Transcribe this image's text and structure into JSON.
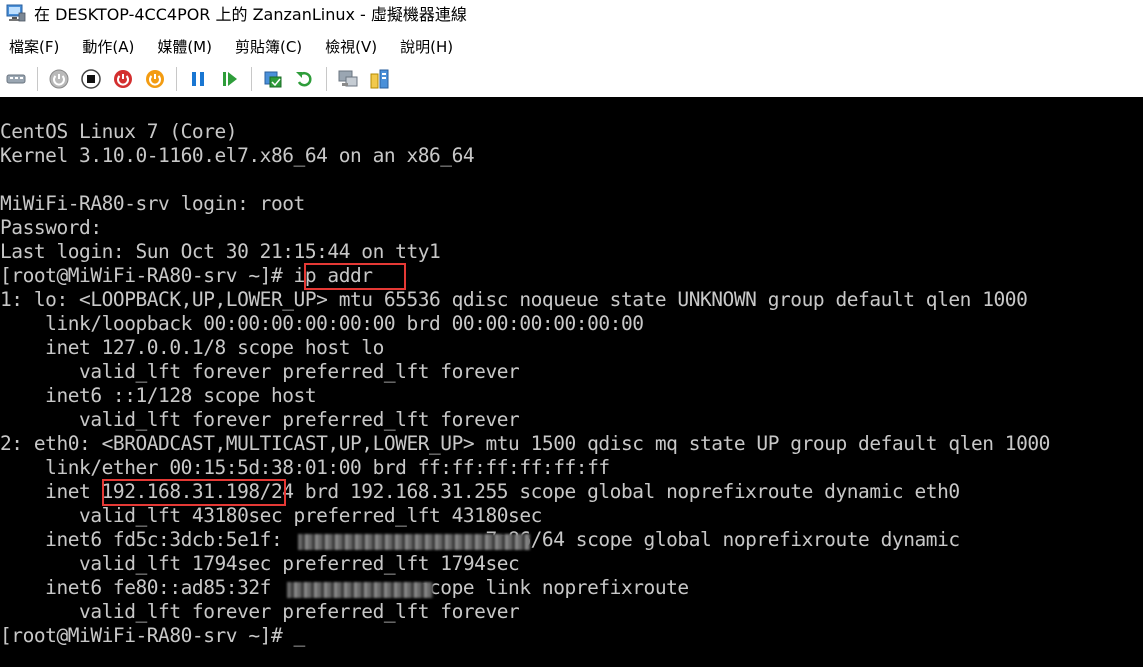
{
  "window": {
    "title": "在 DESKTOP-4CC4POR 上的 ZanzanLinux - 虛擬機器連線"
  },
  "menu": {
    "items": [
      {
        "id": "file",
        "label": "檔案(F)"
      },
      {
        "id": "action",
        "label": "動作(A)"
      },
      {
        "id": "media",
        "label": "媒體(M)"
      },
      {
        "id": "clipboard",
        "label": "剪貼簿(C)"
      },
      {
        "id": "view",
        "label": "檢視(V)"
      },
      {
        "id": "help",
        "label": "說明(H)"
      }
    ]
  },
  "toolbar": {
    "icons": [
      "ctrl-alt-del-icon",
      "start-icon",
      "turn-off-icon",
      "shutdown-icon",
      "save-icon",
      "pause-icon",
      "resume-icon",
      "checkpoint-icon",
      "revert-icon",
      "enhanced-session-icon",
      "share-icon"
    ],
    "colors": {
      "red": "#d32f2f",
      "orange": "#f39c12",
      "blue": "#1976d2",
      "green": "#2e9d3a",
      "gray": "#8a8a8a"
    }
  },
  "console": {
    "lines": [
      "CentOS Linux 7 (Core)",
      "Kernel 3.10.0-1160.el7.x86_64 on an x86_64",
      "",
      "MiWiFi-RA80-srv login: root",
      "Password:",
      "Last login: Sun Oct 30 21:15:44 on tty1",
      "[root@MiWiFi-RA80-srv ~]# ip addr",
      "1: lo: <LOOPBACK,UP,LOWER_UP> mtu 65536 qdisc noqueue state UNKNOWN group default qlen 1000",
      "    link/loopback 00:00:00:00:00:00 brd 00:00:00:00:00:00",
      "    inet 127.0.0.1/8 scope host lo",
      "       valid_lft forever preferred_lft forever",
      "    inet6 ::1/128 scope host",
      "       valid_lft forever preferred_lft forever",
      "2: eth0: <BROADCAST,MULTICAST,UP,LOWER_UP> mtu 1500 qdisc mq state UP group default qlen 1000",
      "    link/ether 00:15:5d:38:01:00 brd ff:ff:ff:ff:ff:ff",
      "    inet 192.168.31.198/24 brd 192.168.31.255 scope global noprefixroute dynamic eth0",
      "       valid_lft 43180sec preferred_lft 43180sec",
      "    inet6 fd5c:3dcb:5e1f:                 :7e86/64 scope global noprefixroute dynamic",
      "       valid_lft 1794sec preferred_lft 1794sec",
      "    inet6 fe80::ad85:32f             scope link noprefixroute",
      "       valid_lft forever preferred_lft forever",
      "[root@MiWiFi-RA80-srv ~]# _"
    ]
  }
}
